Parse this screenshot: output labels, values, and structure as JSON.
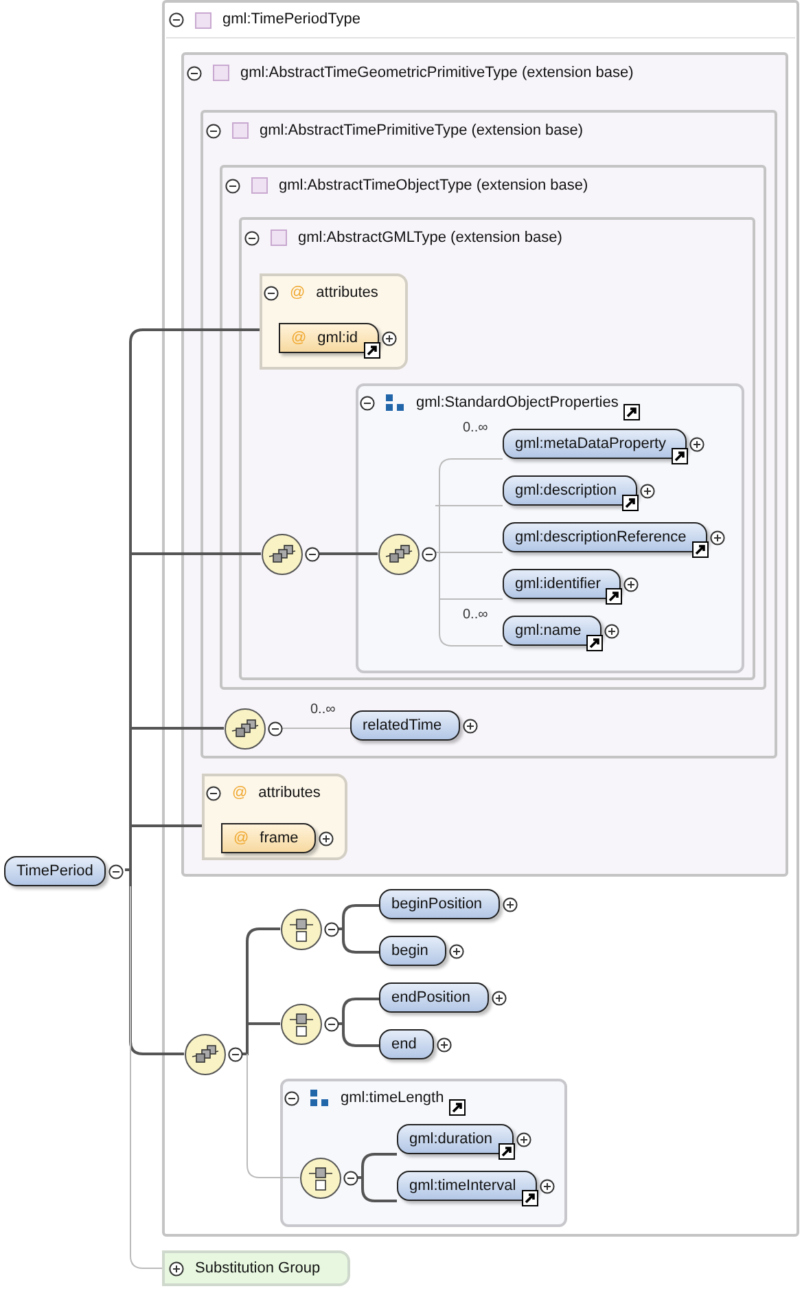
{
  "type_boxes": [
    {
      "title": "gml:TimePeriodType",
      "expanded": true
    },
    {
      "title": "gml:AbstractTimeGeometricPrimitiveType (extension base)",
      "expanded": true
    },
    {
      "title": "gml:AbstractTimePrimitiveType (extension base)",
      "expanded": true
    },
    {
      "title": "gml:AbstractTimeObjectType (extension base)",
      "expanded": true
    },
    {
      "title": "gml:AbstractGMLType (extension base)",
      "expanded": true
    }
  ],
  "attribute_groups": [
    {
      "icon": "@",
      "title": "attributes",
      "expanded": true,
      "attributes": [
        {
          "icon": "@",
          "name": "gml:id",
          "reference": true,
          "expanded": false
        }
      ]
    },
    {
      "icon": "@",
      "title": "attributes",
      "expanded": true,
      "attributes": [
        {
          "icon": "@",
          "name": "frame",
          "reference": false,
          "expanded": false
        }
      ]
    }
  ],
  "groups": [
    {
      "title": "gml:StandardObjectProperties",
      "expanded": true,
      "reference": true,
      "elements": [
        {
          "name": "gml:metaDataProperty",
          "occurs": "0..∞",
          "reference": true,
          "expanded": false
        },
        {
          "name": "gml:description",
          "reference": true,
          "expanded": false
        },
        {
          "name": "gml:descriptionReference",
          "reference": true,
          "expanded": false
        },
        {
          "name": "gml:identifier",
          "reference": true,
          "expanded": false
        },
        {
          "name": "gml:name",
          "occurs": "0..∞",
          "reference": true,
          "expanded": false
        }
      ]
    },
    {
      "title": "gml:timeLength",
      "expanded": true,
      "reference": true,
      "elements": [
        {
          "name": "gml:duration",
          "reference": true,
          "expanded": false
        },
        {
          "name": "gml:timeInterval",
          "reference": true,
          "expanded": false
        }
      ]
    }
  ],
  "elements": [
    {
      "name": "relatedTime",
      "occurs": "0..∞",
      "reference": false,
      "expanded": false
    },
    {
      "name": "beginPosition",
      "reference": false,
      "expanded": false
    },
    {
      "name": "begin",
      "reference": false,
      "expanded": false
    },
    {
      "name": "endPosition",
      "reference": false,
      "expanded": false
    },
    {
      "name": "end",
      "reference": false,
      "expanded": false
    }
  ],
  "compositors": [
    {
      "kind": "sequence",
      "expanded": true
    },
    {
      "kind": "sequence",
      "expanded": true
    },
    {
      "kind": "sequence",
      "expanded": true
    },
    {
      "kind": "sequence",
      "expanded": true
    },
    {
      "kind": "choice",
      "expanded": true
    },
    {
      "kind": "choice",
      "expanded": true
    },
    {
      "kind": "choice",
      "expanded": true
    }
  ],
  "root": {
    "label": "TimePeriod",
    "expanded": true
  },
  "substitution_group": {
    "label": "Substitution Group",
    "expanded": false
  }
}
